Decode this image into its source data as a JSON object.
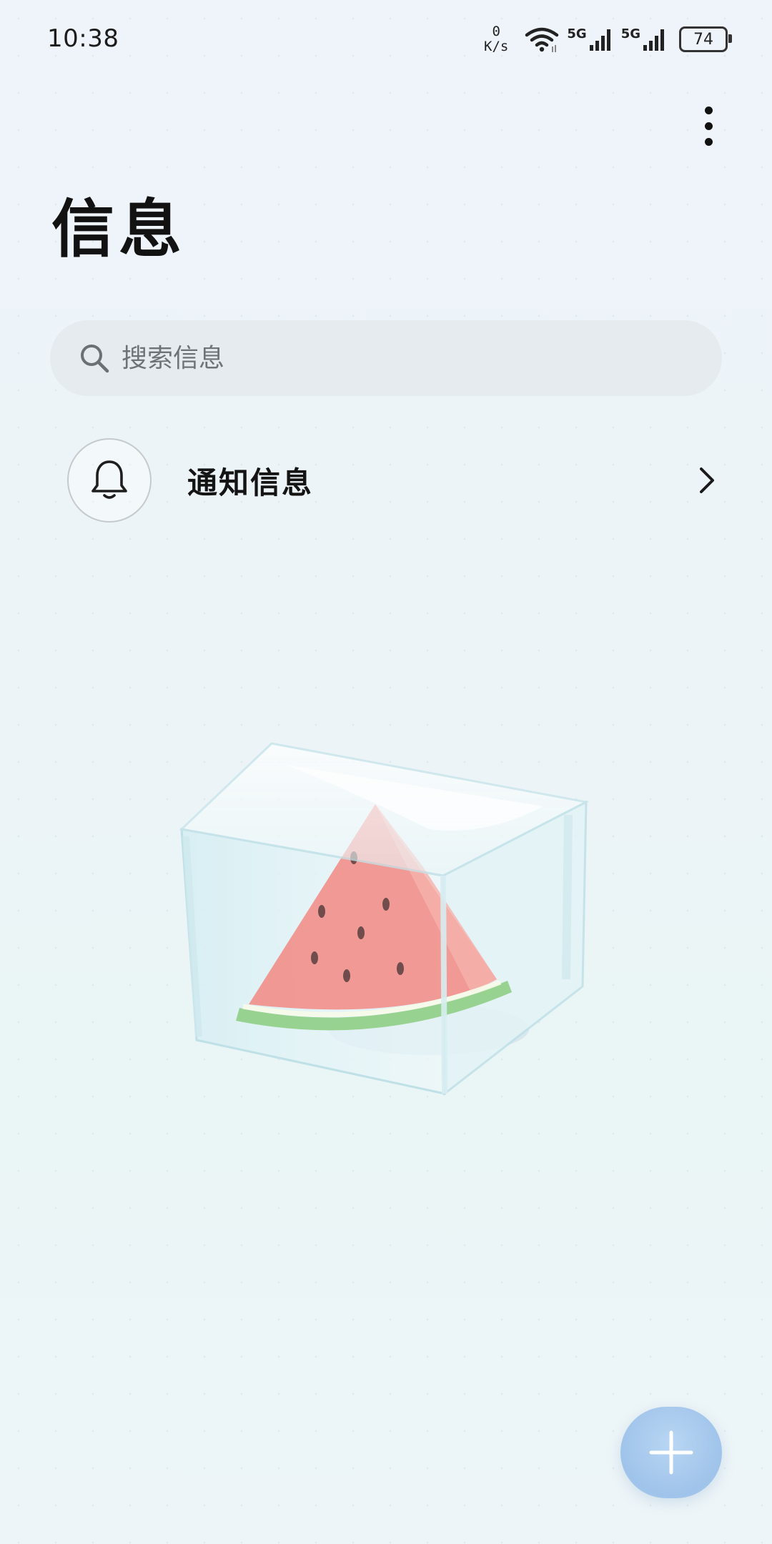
{
  "status_bar": {
    "time": "10:38",
    "net_speed_value": "0",
    "net_speed_unit": "K/s",
    "sim1_label": "5G",
    "sim2_label": "5G",
    "battery_level": "74"
  },
  "header": {
    "title": "信息",
    "more_icon": "more-vertical-icon"
  },
  "search": {
    "placeholder": "搜索信息",
    "icon": "search-icon"
  },
  "notification_entry": {
    "label": "通知信息",
    "icon": "bell-icon",
    "chevron_icon": "chevron-right-icon"
  },
  "empty_state": {
    "illustration": "watermelon-in-ice-cube"
  },
  "fab": {
    "icon": "plus-icon",
    "color": "#a6c8ee"
  }
}
